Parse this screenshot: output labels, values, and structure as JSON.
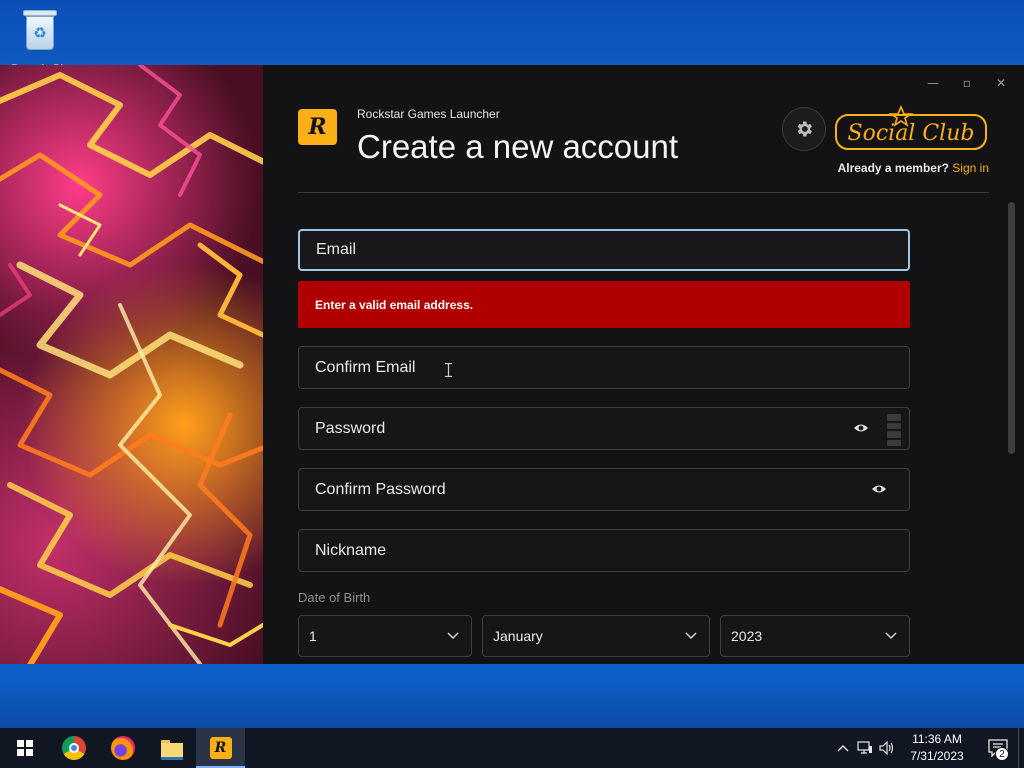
{
  "desktop": {
    "recycle_bin_label": "Recycle Bin"
  },
  "window": {
    "app_name": "Rockstar Games Launcher",
    "title": "Create a new account",
    "logo_text": "R",
    "social_club_text": "Social Club",
    "already_member": "Already a member?",
    "sign_in": "Sign in",
    "controls": {
      "minimize": "—",
      "maximize": "▫",
      "close": "✕"
    }
  },
  "form": {
    "email_placeholder": "Email",
    "email_error": "Enter a valid email address.",
    "confirm_email_placeholder": "Confirm Email",
    "password_placeholder": "Password",
    "confirm_password_placeholder": "Confirm Password",
    "nickname_placeholder": "Nickname",
    "dob_label": "Date of Birth",
    "dob_day": "1",
    "dob_month": "January",
    "dob_year": "2023"
  },
  "taskbar": {
    "time": "11:36 AM",
    "date": "7/31/2023",
    "notification_count": "2",
    "tray_icons": [
      "chevron-up-icon",
      "network-icon",
      "volume-icon"
    ],
    "apps": [
      "windows-start-icon",
      "chrome-icon",
      "firefox-icon",
      "file-explorer-icon",
      "rockstar-launcher-icon"
    ]
  },
  "colors": {
    "accent": "#fcaf17",
    "error": "#b00000",
    "focus_border": "#9fc6e6",
    "panel_bg": "#131315"
  }
}
